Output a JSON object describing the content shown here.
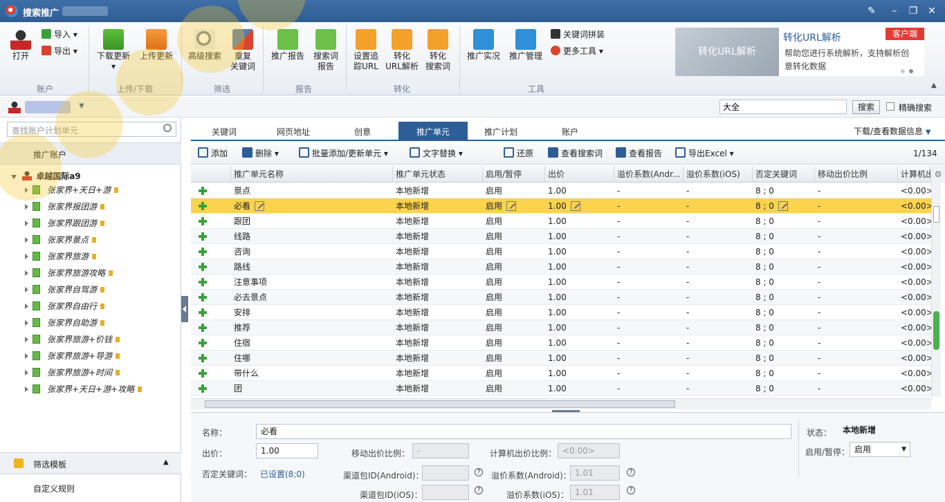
{
  "window": {
    "title": "搜索推广"
  },
  "ribbon": {
    "open": "打开",
    "import": "导入",
    "export": "导出",
    "download_update": "下载更新",
    "upload_update": "上传更新",
    "advanced_search": "高级搜索",
    "dup_keyword_1": "重复",
    "dup_keyword_2": "关键词",
    "promo_report": "推广报告",
    "search_term_1": "搜索词",
    "search_term_2": "报告",
    "set_track_1": "设置追",
    "set_track_2": "踪URL",
    "convert_url_1": "转化",
    "convert_url_2": "URL解析",
    "convert_search_1": "转化",
    "convert_search_2": "搜索词",
    "promo_live": "推广实况",
    "promo_manage": "推广管理",
    "keyword_splice": "关键词拼装",
    "more_tools": "更多工具",
    "groups": {
      "account": "账户",
      "upload_download": "上传/下载",
      "filter": "筛选",
      "report": "报告",
      "convert": "转化",
      "tools": "工具"
    }
  },
  "ad": {
    "image_text": "转化URL解析",
    "title": "转化URL解析",
    "badge": "客户端",
    "desc1": "帮助您进行系统解析，支持解析创",
    "desc2": "意转化数据"
  },
  "topsearch": {
    "value": "大全",
    "button": "搜索",
    "exact": "精确搜索"
  },
  "left": {
    "search_placeholder": "查找账户计划单元",
    "root_label": "推广账户",
    "account_name": "卓越国际a9",
    "plans": [
      "张家界+天日+游",
      "张家界报团游",
      "张家界跟团游",
      "张家界景点",
      "张家界旅游",
      "张家界旅游攻略",
      "张家界自驾游",
      "张家界自由行",
      "张家界自助游",
      "张家界旅游+价钱",
      "张家界旅游+导游",
      "张家界旅游+时间",
      "张家界+天日+游+攻略"
    ],
    "filter_template": "筛选模板",
    "custom_rule": "自定义规则"
  },
  "tabs": [
    "关键词",
    "网页地址",
    "创意",
    "推广单元",
    "推广计划",
    "账户"
  ],
  "download_view": "下载/查看数据信息",
  "toolbar": {
    "add": "添加",
    "delete": "删除",
    "batch": "批量添加/更新单元",
    "replace": "文字替换",
    "restore": "还原",
    "view_search": "查看搜索词",
    "view_report": "查看报告",
    "export_excel": "导出Excel",
    "page": "1/134"
  },
  "columns": [
    "推广单元名称",
    "推广单元状态",
    "启用/暂停",
    "出价",
    "溢价系数(Andr...",
    "溢价系数(iOS)",
    "否定关键词",
    "移动出价比例",
    "计算机出"
  ],
  "rows": [
    {
      "name": "景点",
      "status": "本地新增",
      "enable": "启用",
      "bid": "1.00",
      "andr": "-",
      "ios": "-",
      "neg": "8 ; 0",
      "mob": "-",
      "pc": "<0.00>"
    },
    {
      "name": "必看",
      "status": "本地新增",
      "enable": "启用",
      "bid": "1.00",
      "andr": "-",
      "ios": "-",
      "neg": "8 ; 0",
      "mob": "-",
      "pc": "<0.00>"
    },
    {
      "name": "跟团",
      "status": "本地新增",
      "enable": "启用",
      "bid": "1.00",
      "andr": "-",
      "ios": "-",
      "neg": "8 ; 0",
      "mob": "-",
      "pc": "<0.00>"
    },
    {
      "name": "线路",
      "status": "本地新增",
      "enable": "启用",
      "bid": "1.00",
      "andr": "-",
      "ios": "-",
      "neg": "8 ; 0",
      "mob": "-",
      "pc": "<0.00>"
    },
    {
      "name": "咨询",
      "status": "本地新增",
      "enable": "启用",
      "bid": "1.00",
      "andr": "-",
      "ios": "-",
      "neg": "8 ; 0",
      "mob": "-",
      "pc": "<0.00>"
    },
    {
      "name": "路线",
      "status": "本地新增",
      "enable": "启用",
      "bid": "1.00",
      "andr": "-",
      "ios": "-",
      "neg": "8 ; 0",
      "mob": "-",
      "pc": "<0.00>"
    },
    {
      "name": "注意事项",
      "status": "本地新增",
      "enable": "启用",
      "bid": "1.00",
      "andr": "-",
      "ios": "-",
      "neg": "8 ; 0",
      "mob": "-",
      "pc": "<0.00>"
    },
    {
      "name": "必去景点",
      "status": "本地新增",
      "enable": "启用",
      "bid": "1.00",
      "andr": "-",
      "ios": "-",
      "neg": "8 ; 0",
      "mob": "-",
      "pc": "<0.00>"
    },
    {
      "name": "安排",
      "status": "本地新增",
      "enable": "启用",
      "bid": "1.00",
      "andr": "-",
      "ios": "-",
      "neg": "8 ; 0",
      "mob": "-",
      "pc": "<0.00>"
    },
    {
      "name": "推荐",
      "status": "本地新增",
      "enable": "启用",
      "bid": "1.00",
      "andr": "-",
      "ios": "-",
      "neg": "8 ; 0",
      "mob": "-",
      "pc": "<0.00>"
    },
    {
      "name": "住宿",
      "status": "本地新增",
      "enable": "启用",
      "bid": "1.00",
      "andr": "-",
      "ios": "-",
      "neg": "8 ; 0",
      "mob": "-",
      "pc": "<0.00>"
    },
    {
      "name": "住哪",
      "status": "本地新增",
      "enable": "启用",
      "bid": "1.00",
      "andr": "-",
      "ios": "-",
      "neg": "8 ; 0",
      "mob": "-",
      "pc": "<0.00>"
    },
    {
      "name": "带什么",
      "status": "本地新增",
      "enable": "启用",
      "bid": "1.00",
      "andr": "-",
      "ios": "-",
      "neg": "8 ; 0",
      "mob": "-",
      "pc": "<0.00>"
    },
    {
      "name": "团",
      "status": "本地新增",
      "enable": "启用",
      "bid": "1.00",
      "andr": "-",
      "ios": "-",
      "neg": "8 ; 0",
      "mob": "-",
      "pc": "<0.00>"
    }
  ],
  "detail": {
    "name_label": "名称：",
    "name_value": "必看",
    "bid_label": "出价：",
    "bid_value": "1.00",
    "mobile_ratio_label": "移动出价比例：",
    "mobile_ratio_value": "-",
    "pc_ratio_label": "计算机出价比例：",
    "pc_ratio_value": "<0.00>",
    "neg_label": "否定关键词：",
    "neg_value": "已设置(8;0)",
    "android_id_label": "渠道包ID(Android)：",
    "android_premium_label": "溢价系数(Android)：",
    "android_premium_value": "1.01",
    "ios_id_label": "渠道包ID(iOS)：",
    "ios_premium_label": "溢价系数(iOS)：",
    "ios_premium_value": "1.01",
    "state_label": "状态：",
    "state_value": "本地新增",
    "enable_label": "启用/暂停：",
    "enable_value": "启用"
  }
}
